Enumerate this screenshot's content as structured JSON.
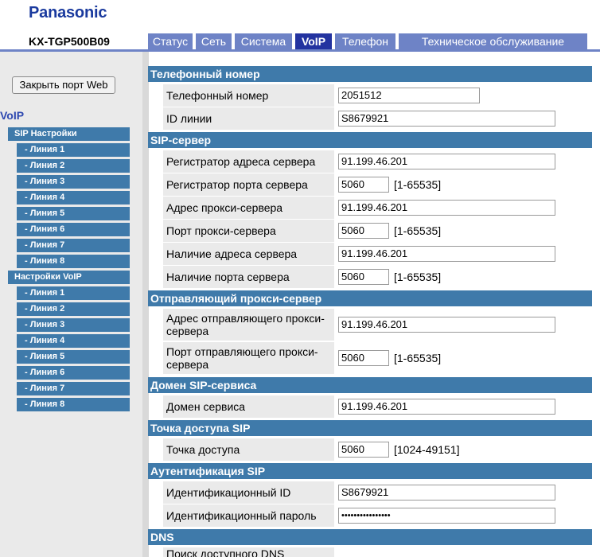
{
  "brand": "Panasonic",
  "model": "KX-TGP500B09",
  "nav": {
    "tabs": [
      {
        "label": "Статус",
        "active": false
      },
      {
        "label": "Сеть",
        "active": false
      },
      {
        "label": "Система",
        "active": false
      },
      {
        "label": "VoIP",
        "active": true
      },
      {
        "label": "Телефон",
        "active": false
      },
      {
        "label": "Техническое обслуживание",
        "active": false
      }
    ]
  },
  "sidebar": {
    "close_button": "Закрыть порт Web",
    "title": "VoIP",
    "sip_settings": "SIP Настройки",
    "sip_lines": [
      "- Линия 1",
      "- Линия 2",
      "- Линия 3",
      "- Линия 4",
      "- Линия 5",
      "- Линия 6",
      "- Линия 7",
      "- Линия 8"
    ],
    "voip_settings": "Настройки VoIP",
    "voip_lines": [
      "- Линия 1",
      "- Линия 2",
      "- Линия 3",
      "- Линия 4",
      "- Линия 5",
      "- Линия 6",
      "- Линия 7",
      "- Линия 8"
    ]
  },
  "sections": {
    "phone": {
      "title": "Телефонный номер",
      "phone_number_label": "Телефонный номер",
      "phone_number_value": "2051512",
      "line_id_label": "ID линии",
      "line_id_value": "S8679921"
    },
    "sip_server": {
      "title": "SIP-сервер",
      "registrar_addr_label": "Регистратор адреса сервера",
      "registrar_addr_value": "91.199.46.201",
      "registrar_port_label": "Регистратор порта сервера",
      "registrar_port_value": "5060",
      "registrar_port_range": "[1-65535]",
      "proxy_addr_label": "Адрес прокси-сервера",
      "proxy_addr_value": "91.199.46.201",
      "proxy_port_label": "Порт прокси-сервера",
      "proxy_port_value": "5060",
      "proxy_port_range": "[1-65535]",
      "presence_addr_label": "Наличие адреса сервера",
      "presence_addr_value": "91.199.46.201",
      "presence_port_label": "Наличие порта сервера",
      "presence_port_value": "5060",
      "presence_port_range": "[1-65535]"
    },
    "outbound_proxy": {
      "title": "Отправляющий прокси-сервер",
      "addr_label": "Адрес отправляющего прокси-сервера",
      "addr_value": "91.199.46.201",
      "port_label": "Порт отправляющего прокси-сервера",
      "port_value": "5060",
      "port_range": "[1-65535]"
    },
    "sip_domain": {
      "title": "Домен SIP-сервиса",
      "domain_label": "Домен сервиса",
      "domain_value": "91.199.46.201"
    },
    "sip_port": {
      "title": "Точка доступа SIP",
      "port_label": "Точка доступа",
      "port_value": "5060",
      "port_range": "[1024-49151]"
    },
    "auth": {
      "title": "Аутентификация SIP",
      "id_label": "Идентификационный ID",
      "id_value": "S8679921",
      "password_label": "Идентификационный пароль",
      "password_value": "••••••••••••••••"
    },
    "dns": {
      "title": "DNS",
      "search_label": "Поиск доступного DNS"
    }
  }
}
